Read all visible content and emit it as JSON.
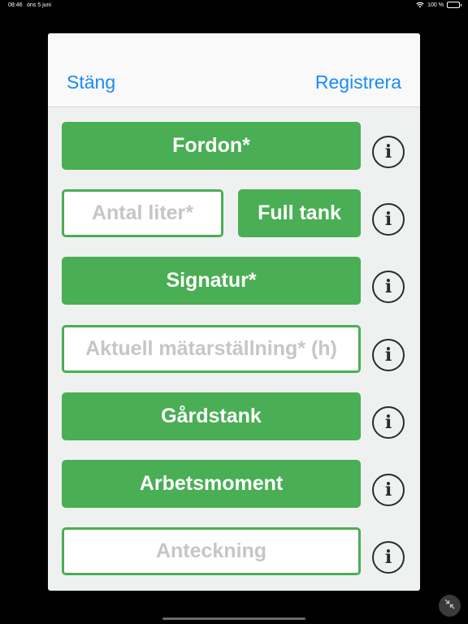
{
  "status_bar": {
    "time": "08:46",
    "date": "ons 5 juni",
    "battery": "100 %"
  },
  "header": {
    "close_label": "Stäng",
    "register_label": "Registrera"
  },
  "form": {
    "vehicle_label": "Fordon*",
    "liters_placeholder": "Antal liter*",
    "full_tank_label": "Full tank",
    "signature_label": "Signatur*",
    "meter_placeholder": "Aktuell mätarställning* (h)",
    "farm_tank_label": "Gårdstank",
    "work_task_label": "Arbetsmoment",
    "note_placeholder": "Anteckning"
  },
  "icons": {
    "info": "info-icon",
    "wifi": "wifi-icon",
    "battery": "battery-icon",
    "collapse": "collapse-icon"
  },
  "colors": {
    "accent_green": "#49ae54",
    "link_blue": "#1a8cf7",
    "placeholder_gray": "#c4c6c8"
  }
}
